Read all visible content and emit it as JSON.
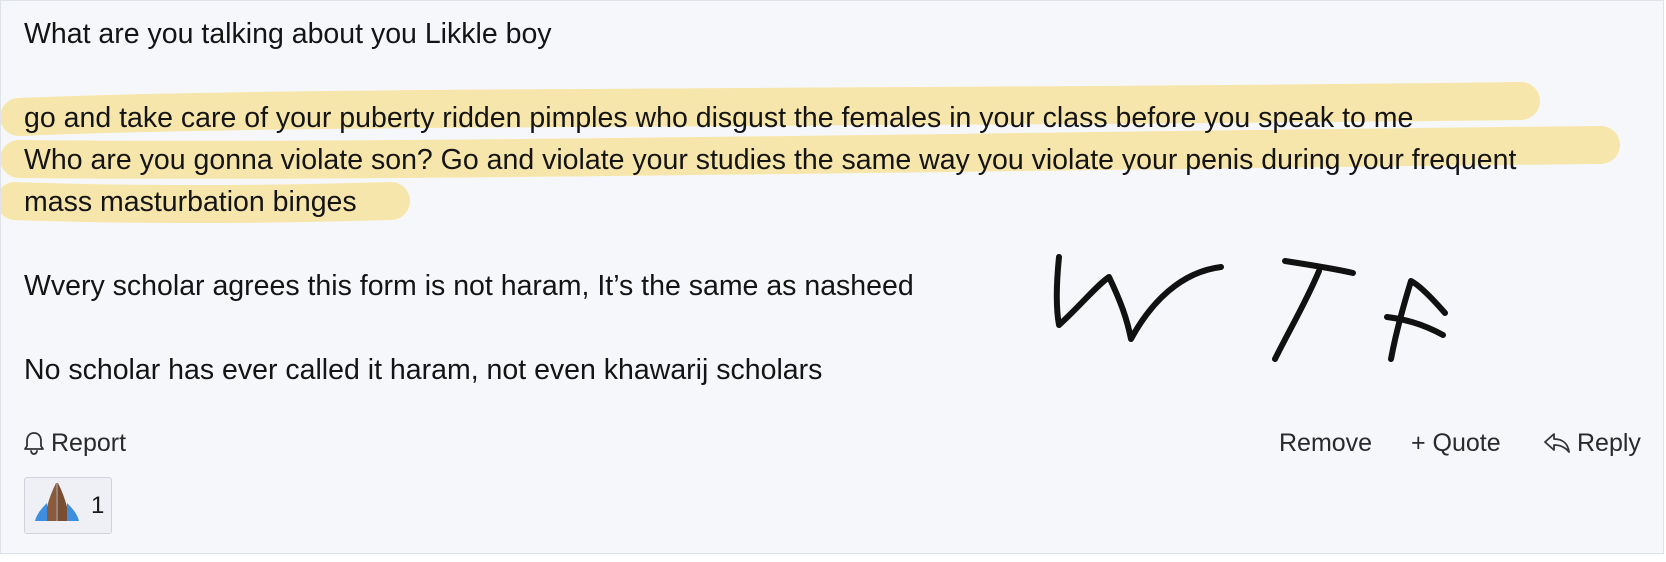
{
  "post": {
    "lines": [
      "What are you talking about you Likkle boy",
      "go and take care of your puberty ridden pimples who disgust the females in your class before you speak to me",
      "Who are you gonna violate son? Go and violate your studies the same way you violate your penis during your frequent",
      "mass masturbation binges",
      "Wvery scholar agrees this form is not haram, It’s the same as nasheed",
      "No scholar has ever called it haram, not even khawarij scholars"
    ],
    "handwritten_annotation": "WTF",
    "highlight_color": "#f8d96b"
  },
  "actions": {
    "report_label": "Report",
    "remove_label": "Remove",
    "quote_label": "+ Quote",
    "reply_label": "Reply"
  },
  "icons": {
    "report": "bell-icon",
    "reply": "reply-arrow-icon",
    "reaction": "folded-hands-emoji"
  },
  "reaction": {
    "count": "1"
  }
}
